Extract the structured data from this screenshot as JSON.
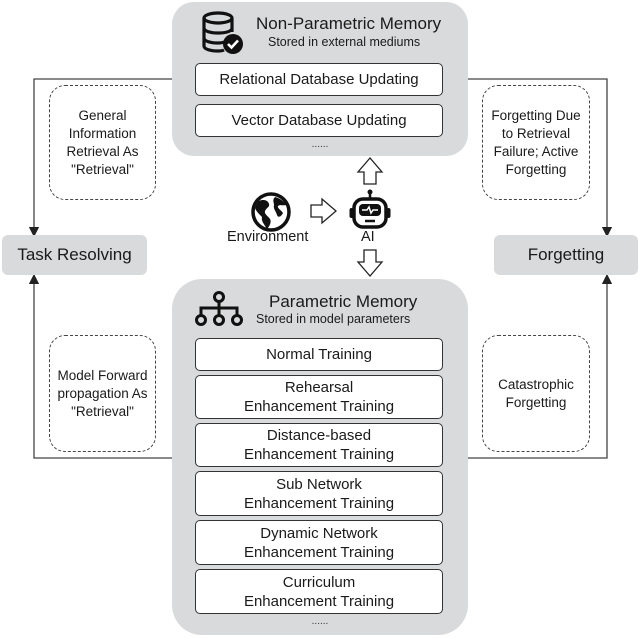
{
  "non_parametric": {
    "title": "Non-Parametric Memory",
    "subtitle": "Stored in external mediums",
    "icon": "database-check-icon",
    "items": [
      "Relational Database Updating",
      "Vector Database Updating"
    ],
    "more": "......"
  },
  "parametric": {
    "title": "Parametric Memory",
    "subtitle": "Stored in model parameters",
    "icon": "hierarchy-icon",
    "items": [
      {
        "line1": "Normal Training",
        "line2": ""
      },
      {
        "line1": "Rehearsal",
        "line2": "Enhancement Training"
      },
      {
        "line1": "Distance-based",
        "line2": "Enhancement Training"
      },
      {
        "line1": "Sub Network",
        "line2": "Enhancement Training"
      },
      {
        "line1": "Dynamic Network",
        "line2": "Enhancement Training"
      },
      {
        "line1": "Curriculum",
        "line2": "Enhancement Training"
      }
    ],
    "more": "......"
  },
  "center": {
    "environment_label": "Environment",
    "ai_label": "AI"
  },
  "left": {
    "node": "Task Resolving",
    "top_note": [
      "General",
      "Information",
      "Retrieval As",
      "\"Retrieval\""
    ],
    "bottom_note": [
      "Model Forward",
      "propagation As",
      "\"Retrieval\""
    ]
  },
  "right": {
    "node": "Forgetting",
    "top_note": [
      "Forgetting Due",
      "to Retrieval",
      "Failure; Active",
      "Forgetting"
    ],
    "bottom_note": [
      "Catastrophic",
      "Forgetting"
    ]
  }
}
